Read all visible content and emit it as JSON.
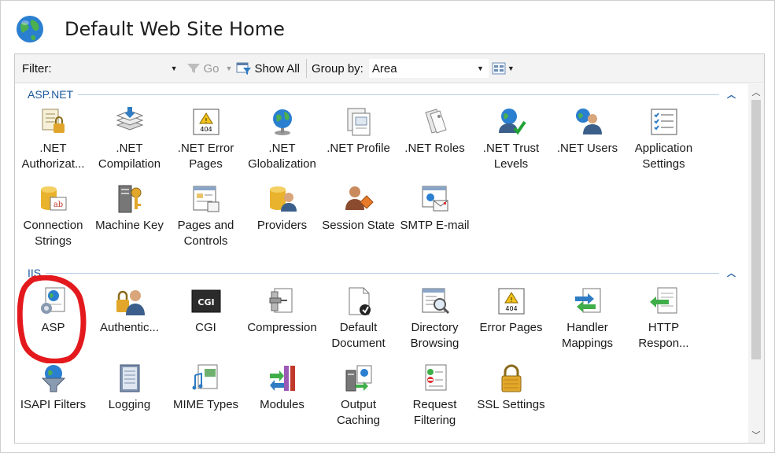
{
  "page": {
    "title": "Default Web Site Home"
  },
  "toolbar": {
    "filter_label": "Filter:",
    "filter_value": "",
    "go_label": "Go",
    "show_all_label": "Show All",
    "group_by_label": "Group by:",
    "group_by_value": "Area"
  },
  "groups": [
    {
      "name": "ASP.NET",
      "items": [
        {
          "label": ".NET Authorizat...",
          "icon": "net-authorization-icon"
        },
        {
          "label": ".NET Compilation",
          "icon": "net-compilation-icon"
        },
        {
          "label": ".NET Error Pages",
          "icon": "net-error-pages-icon"
        },
        {
          "label": ".NET Globalization",
          "icon": "net-globalization-icon"
        },
        {
          "label": ".NET Profile",
          "icon": "net-profile-icon"
        },
        {
          "label": ".NET Roles",
          "icon": "net-roles-icon"
        },
        {
          "label": ".NET Trust Levels",
          "icon": "net-trust-levels-icon"
        },
        {
          "label": ".NET Users",
          "icon": "net-users-icon"
        },
        {
          "label": "Application Settings",
          "icon": "application-settings-icon"
        },
        {
          "label": "Connection Strings",
          "icon": "connection-strings-icon"
        },
        {
          "label": "Machine Key",
          "icon": "machine-key-icon"
        },
        {
          "label": "Pages and Controls",
          "icon": "pages-and-controls-icon"
        },
        {
          "label": "Providers",
          "icon": "providers-icon"
        },
        {
          "label": "Session State",
          "icon": "session-state-icon"
        },
        {
          "label": "SMTP E-mail",
          "icon": "smtp-email-icon"
        }
      ]
    },
    {
      "name": "IIS",
      "items": [
        {
          "label": "ASP",
          "icon": "asp-icon"
        },
        {
          "label": "Authentic...",
          "icon": "authentication-icon"
        },
        {
          "label": "CGI",
          "icon": "cgi-icon"
        },
        {
          "label": "Compression",
          "icon": "compression-icon"
        },
        {
          "label": "Default Document",
          "icon": "default-document-icon"
        },
        {
          "label": "Directory Browsing",
          "icon": "directory-browsing-icon"
        },
        {
          "label": "Error Pages",
          "icon": "error-pages-icon"
        },
        {
          "label": "Handler Mappings",
          "icon": "handler-mappings-icon"
        },
        {
          "label": "HTTP Respon...",
          "icon": "http-response-icon"
        },
        {
          "label": "ISAPI Filters",
          "icon": "isapi-filters-icon"
        },
        {
          "label": "Logging",
          "icon": "logging-icon"
        },
        {
          "label": "MIME Types",
          "icon": "mime-types-icon"
        },
        {
          "label": "Modules",
          "icon": "modules-icon"
        },
        {
          "label": "Output Caching",
          "icon": "output-caching-icon"
        },
        {
          "label": "Request Filtering",
          "icon": "request-filtering-icon"
        },
        {
          "label": "SSL Settings",
          "icon": "ssl-settings-icon"
        }
      ]
    }
  ],
  "annotation": {
    "highlight_color": "#e3191d",
    "highlighted_item": "ASP"
  }
}
